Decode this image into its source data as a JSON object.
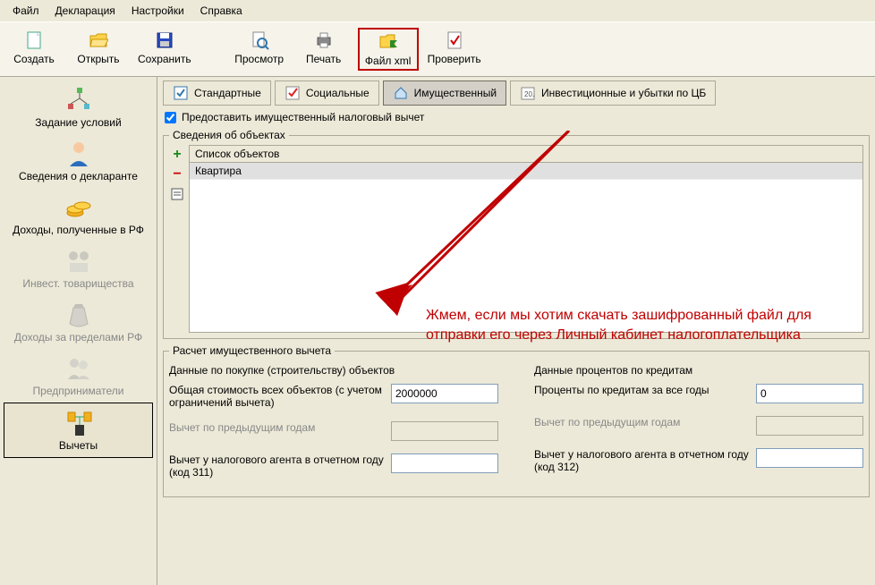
{
  "menu": {
    "items": [
      "Файл",
      "Декларация",
      "Настройки",
      "Справка"
    ]
  },
  "toolbar": {
    "create": "Создать",
    "open": "Открыть",
    "save": "Сохранить",
    "preview": "Просмотр",
    "print": "Печать",
    "filexml": "Файл xml",
    "check": "Проверить"
  },
  "sidebar": {
    "items": [
      {
        "label": "Задание условий",
        "muted": false
      },
      {
        "label": "Сведения о декларанте",
        "muted": false
      },
      {
        "label": "Доходы, полученные в РФ",
        "muted": false
      },
      {
        "label": "Инвест. товарищества",
        "muted": true
      },
      {
        "label": "Доходы за пределами РФ",
        "muted": true
      },
      {
        "label": "Предприниматели",
        "muted": true
      },
      {
        "label": "Вычеты",
        "muted": false,
        "active": true
      }
    ]
  },
  "tabs": {
    "standard": "Стандартные",
    "social": "Социальные",
    "property": "Имущественный",
    "invest": "Инвестиционные и убытки по ЦБ"
  },
  "provide_deduction_checkbox": "Предоставить имущественный налоговый вычет",
  "objects_section": {
    "legend": "Сведения об объектах",
    "list_header": "Список объектов",
    "rows": [
      "Квартира"
    ]
  },
  "annotation": "Жмем, если мы хотим скачать зашифрованный файл для отправки его через Личный кабинет налогоплательщика",
  "calc": {
    "legend": "Расчет имущественного вычета",
    "left_title": "Данные по покупке (строительству) объектов",
    "right_title": "Данные процентов по кредитам",
    "left": {
      "total_cost_label": "Общая стоимость всех объектов (с учетом ограничений вычета)",
      "total_cost_value": "2000000",
      "prev_years_label": "Вычет по предыдущим годам",
      "prev_years_value": "",
      "agent_label": "Вычет у налогового агента в отчетном году (код 311)",
      "agent_value": ""
    },
    "right": {
      "interest_label": "Проценты по кредитам за все годы",
      "interest_value": "0",
      "prev_years_label": "Вычет по предыдущим годам",
      "prev_years_value": "",
      "agent_label": "Вычет у налогового агента в отчетном году (код 312)",
      "agent_value": ""
    }
  }
}
